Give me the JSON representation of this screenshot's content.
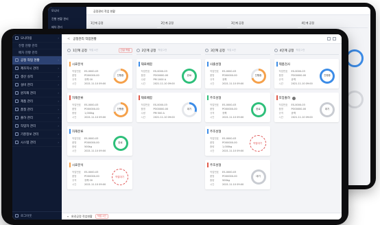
{
  "back": {
    "sidebar": [
      "모니터",
      "진행 현황 관리",
      "배차 관리",
      "공정 관리"
    ],
    "header_title": "공정관리 작업 현황",
    "columns": [
      "1단계 공정",
      "2단계 공정",
      "3단계 공정",
      "4단계 공정"
    ]
  },
  "app": {
    "title": "공정관리 작업현황",
    "sidebar": [
      {
        "label": "모니터링",
        "type": "main"
      },
      {
        "label": "진행 현황 관리",
        "type": "sub"
      },
      {
        "label": "배차 현황 관리",
        "type": "sub"
      },
      {
        "label": "공정 작업 현황",
        "type": "main",
        "active": true
      },
      {
        "label": "제조지시 관리",
        "type": "main"
      },
      {
        "label": "생산 실적",
        "type": "main"
      },
      {
        "label": "설비 관리",
        "type": "main"
      },
      {
        "label": "원자재 관리",
        "type": "main"
      },
      {
        "label": "제품 관리",
        "type": "main"
      },
      {
        "label": "품질 관리",
        "type": "main"
      },
      {
        "label": "출하 관리",
        "type": "main"
      },
      {
        "label": "작업자 관리",
        "type": "main"
      },
      {
        "label": "기준정보 관리",
        "type": "main"
      },
      {
        "label": "시스템 관리",
        "type": "main"
      }
    ],
    "sidebar_footer": "로그아웃",
    "columns": [
      {
        "title": "1단계 공정",
        "count": "작업 4건",
        "tag": "긴급 작업",
        "cards": [
          {
            "title": "시료분석",
            "accent": "#f5a14b",
            "rows": [
              [
                "작업번호",
                "ES-0000-03"
              ],
              [
                "품명",
                "PO00000-00"
              ],
              [
                "규격",
                "규격 00"
              ],
              [
                "시간",
                "2021.11.10 09:00"
              ]
            ],
            "gauge": {
              "color": "#f5a14b",
              "pct": 70,
              "label": "진행중"
            }
          },
          {
            "title": "자재분류",
            "accent": "#e15a4a",
            "rows": [
              [
                "작업번호",
                "ES-0000-03"
              ],
              [
                "품명",
                "PO00000-00"
              ],
              [
                "중량",
                "1,000kg"
              ],
              [
                "시간",
                "2021.11.10 09:00"
              ]
            ],
            "gauge": {
              "color": "#f5a14b",
              "pct": 70,
              "label": "진행중"
            }
          },
          {
            "title": "자재분류",
            "accent": "#3c8ce7",
            "rows": [
              [
                "작업번호",
                "ES-0000-03"
              ],
              [
                "품명",
                "PO00000-00"
              ],
              [
                "중량",
                "500kg"
              ],
              [
                "시간",
                "2021.11.10 09:00"
              ]
            ],
            "gauge": {
              "color": "#2ebf7a",
              "pct": 100,
              "label": "완료"
            }
          },
          {
            "title": "시료분석",
            "accent": "#f5a14b",
            "rows": [
              [
                "작업번호",
                "ES-0000-03"
              ],
              [
                "품명",
                "PO00000-00"
              ],
              [
                "규격",
                "규격 00"
              ],
              [
                "시간",
                "2021.11.10 09:00"
              ]
            ],
            "stamp": "작업대기"
          }
        ]
      },
      {
        "title": "2단계 공정",
        "count": "작업 2건",
        "cards": [
          {
            "title": "재료배합",
            "accent": "#3c8ce7",
            "rows": [
              [
                "작업번호",
                "ES-0000-03"
              ],
              [
                "품명",
                "PO00000-00"
              ],
              [
                "수량",
                "PM 1000 A"
              ],
              [
                "시간",
                "2021.11.10 09:00"
              ]
            ],
            "gauge": {
              "color": "#2ebf7a",
              "pct": 100,
              "label": "완료"
            }
          },
          {
            "title": "재료배합",
            "accent": "#e15a4a",
            "rows": [
              [
                "작업번호",
                "ES-0000-03"
              ],
              [
                "품명",
                "PO00000-00"
              ],
              [
                "수량",
                "PM 500 A"
              ],
              [
                "시간",
                "2021.11.10 09:00"
              ]
            ],
            "gauge": {
              "color": "#3c8ce7",
              "pct": 30,
              "label": "대기"
            }
          }
        ]
      },
      {
        "title": "3단계 공정",
        "count": "작업 4건",
        "cards": [
          {
            "title": "사출성형",
            "accent": "#3c8ce7",
            "rows": [
              [
                "작업번호",
                "ES-0000-03"
              ],
              [
                "품명",
                "PO00000-00"
              ],
              [
                "규격",
                "규격"
              ],
              [
                "시간",
                "2021.11.10 09:00"
              ]
            ],
            "gauge": {
              "color": "#f5a14b",
              "pct": 70,
              "label": "진행중"
            }
          },
          {
            "title": "주조성형",
            "accent": "#2ebf7a",
            "rows": [
              [
                "작업번호",
                "ES-0000-03"
              ],
              [
                "품명",
                "PO00000-00"
              ],
              [
                "규격",
                "규격"
              ],
              [
                "시간",
                "2021.11.10 09:00"
              ]
            ],
            "gauge": {
              "color": "#2ebf7a",
              "pct": 100,
              "label": "완료"
            }
          },
          {
            "title": "주조성형",
            "accent": "#3c8ce7",
            "rows": [
              [
                "작업번호",
                "ES-0000-03"
              ],
              [
                "품명",
                "PO00000-00"
              ],
              [
                "중량",
                "1,000kg"
              ],
              [
                "시간",
                "2021.11.10 09:00"
              ]
            ],
            "stamp": "작업대기"
          },
          {
            "title": "주조성형",
            "accent": "#e15a4a",
            "rows": [
              [
                "작업번호",
                "ES-0000-03"
              ],
              [
                "품명",
                "PO00000-00"
              ],
              [
                "중량",
                "500kg"
              ],
              [
                "시간",
                "2021.11.10 09:00"
              ]
            ],
            "gauge": {
              "color": "#c9ccd2",
              "pct": 100,
              "label": "대기"
            }
          }
        ]
      },
      {
        "title": "4단계 공정",
        "count": "작업 2건",
        "cards": [
          {
            "title": "제품검사",
            "accent": "#3c8ce7",
            "rows": [
              [
                "작업번호",
                "ES-0000-03"
              ],
              [
                "품명",
                "PO00000-00"
              ],
              [
                "규격",
                "규격"
              ],
              [
                "시간",
                "2021.11.10 09:00"
              ]
            ],
            "gauge": {
              "color": "#3c8ce7",
              "pct": 100,
              "label": "진행중"
            }
          },
          {
            "title": "포장출하",
            "accent": "#e15a4a",
            "icon": true,
            "rows": [
              [
                "작업번호",
                "ES-0000-03"
              ],
              [
                "품명",
                "PO00000-00"
              ],
              [
                "규격",
                "규격"
              ],
              [
                "시간",
                "2021.11.10 09:00"
              ]
            ],
            "gauge": {
              "color": "#c9ccd2",
              "pct": 100,
              "label": "대기"
            }
          }
        ]
      }
    ],
    "footer": {
      "label": "완료공정 작업현황",
      "badge": "작업 4건"
    }
  }
}
